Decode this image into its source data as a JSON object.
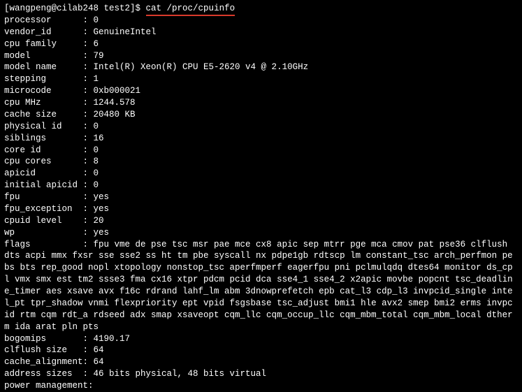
{
  "prompt": {
    "text": "[wangpeng@cilab248 test2]$ ",
    "command": "cat /proc/cpuinfo"
  },
  "fields": [
    {
      "key": "processor",
      "val": "0"
    },
    {
      "key": "vendor_id",
      "val": "GenuineIntel"
    },
    {
      "key": "cpu family",
      "val": "6"
    },
    {
      "key": "model",
      "val": "79"
    },
    {
      "key": "model name",
      "val": "Intel(R) Xeon(R) CPU E5-2620 v4 @ 2.10GHz"
    },
    {
      "key": "stepping",
      "val": "1"
    },
    {
      "key": "microcode",
      "val": "0xb000021"
    },
    {
      "key": "cpu MHz",
      "val": "1244.578"
    },
    {
      "key": "cache size",
      "val": "20480 KB"
    },
    {
      "key": "physical id",
      "val": "0"
    },
    {
      "key": "siblings",
      "val": "16"
    },
    {
      "key": "core id",
      "val": "0"
    },
    {
      "key": "cpu cores",
      "val": "8"
    },
    {
      "key": "apicid",
      "val": "0"
    },
    {
      "key": "initial apicid",
      "val": "0"
    },
    {
      "key": "fpu",
      "val": "yes"
    },
    {
      "key": "fpu_exception",
      "val": "yes"
    },
    {
      "key": "cpuid level",
      "val": "20"
    },
    {
      "key": "wp",
      "val": "yes"
    }
  ],
  "flags": {
    "key": "flags",
    "val": "fpu vme de pse tsc msr pae mce cx8 apic sep mtrr pge mca cmov pat pse36 clflush dts acpi mmx fxsr sse sse2 ss ht tm pbe syscall nx pdpe1gb rdtscp lm constant_tsc arch_perfmon pebs bts rep_good nopl xtopology nonstop_tsc aperfmperf eagerfpu pni pclmulqdq dtes64 monitor ds_cpl vmx smx est tm2 ssse3 fma cx16 xtpr pdcm pcid dca sse4_1 sse4_2 x2apic movbe popcnt tsc_deadline_timer aes xsave avx f16c rdrand lahf_lm abm 3dnowprefetch epb cat_l3 cdp_l3 invpcid_single intel_pt tpr_shadow vnmi flexpriority ept vpid fsgsbase tsc_adjust bmi1 hle avx2 smep bmi2 erms invpcid rtm cqm rdt_a rdseed adx smap xsaveopt cqm_llc cqm_occup_llc cqm_mbm_total cqm_mbm_local dtherm ida arat pln pts"
  },
  "fields2": [
    {
      "key": "bogomips",
      "val": "4190.17"
    },
    {
      "key": "clflush size",
      "val": "64"
    },
    {
      "key": "cache_alignment",
      "val": "64"
    },
    {
      "key": "address sizes",
      "val": "46 bits physical, 48 bits virtual"
    },
    {
      "key": "power management",
      "val": "",
      "nocolon": false,
      "tight": true
    }
  ],
  "keyWidth": 15
}
